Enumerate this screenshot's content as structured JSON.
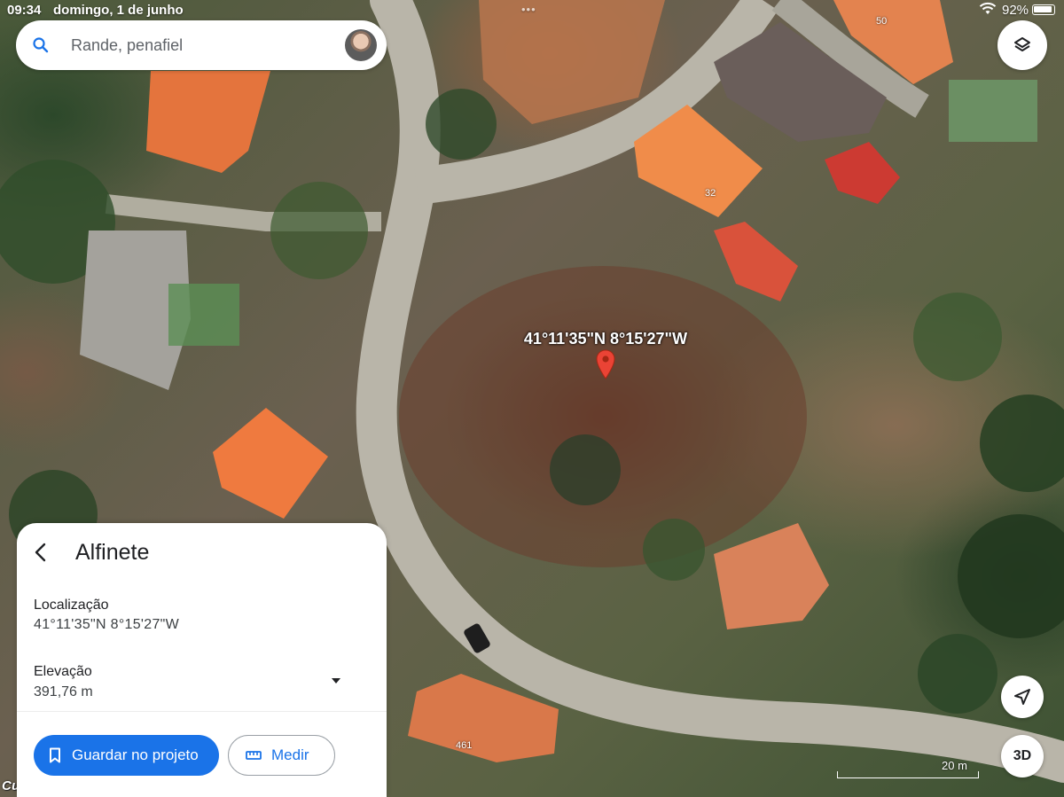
{
  "status_bar": {
    "time": "09:34",
    "date": "domingo, 1 de junho",
    "battery": "92%",
    "icons": [
      "wifi-icon",
      "battery-icon"
    ]
  },
  "search": {
    "query": "Rande, penafiel",
    "icon": "search-icon"
  },
  "map": {
    "pin_coordinates": "41°11'35\"N 8°15'27\"W",
    "house_numbers": [
      "50",
      "32",
      "461"
    ],
    "scale_label": "20 m",
    "buttons": {
      "layers_icon": "layers-icon",
      "locate_icon": "navigation-arrow-icon",
      "three_d": "3D"
    }
  },
  "sheet": {
    "title": "Alfinete",
    "location_label": "Localização",
    "location_value": "41°11'35\"N 8°15'27\"W",
    "elevation_label": "Elevação",
    "elevation_value": "391,76 m",
    "save_label": "Guardar no projeto",
    "measure_label": "Medir"
  },
  "watermark": "CustoJusto.pt",
  "colors": {
    "accent": "#1a73e8",
    "pin": "#ea4335"
  }
}
